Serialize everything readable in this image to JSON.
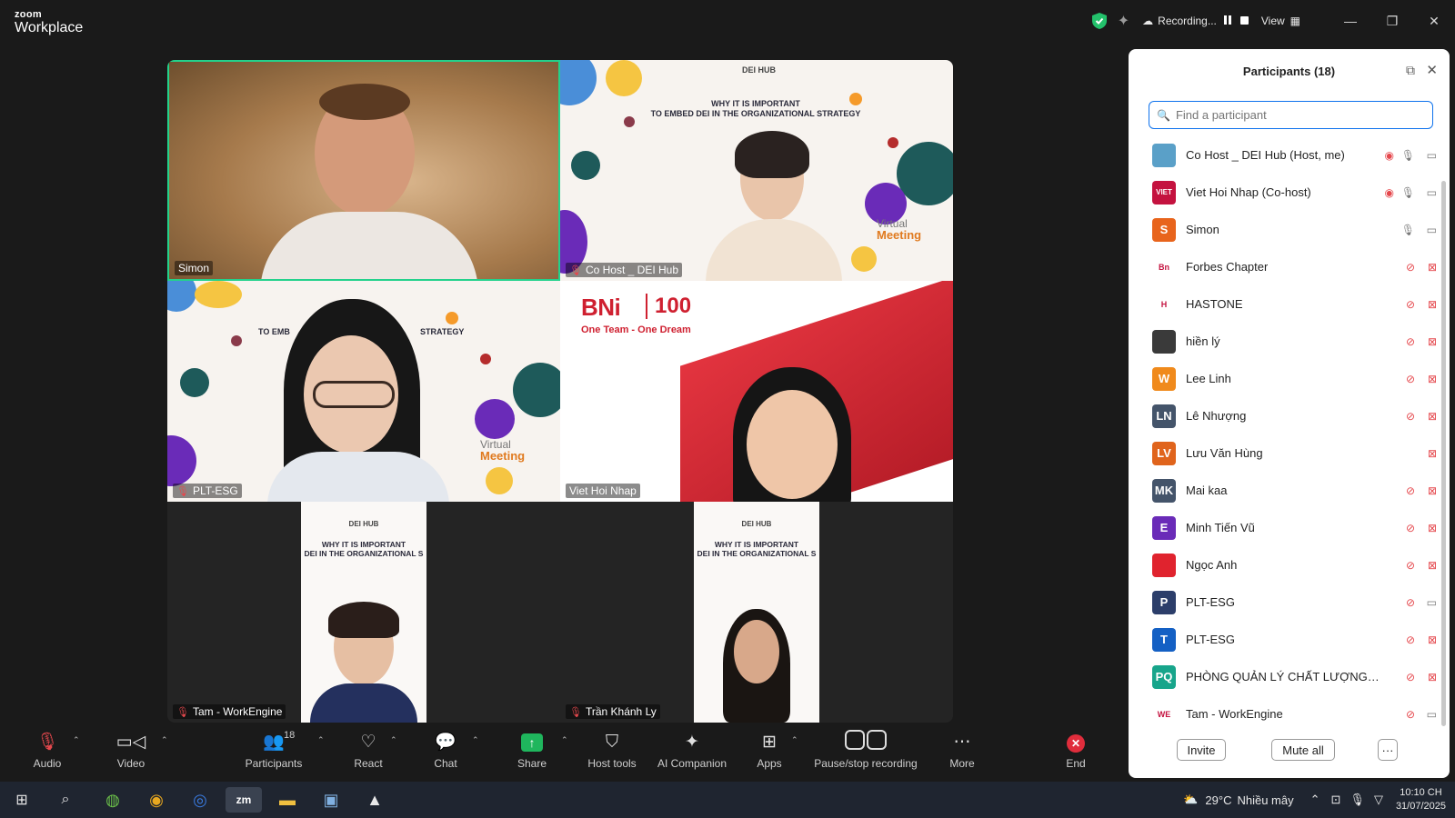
{
  "app": {
    "brand_top": "zoom",
    "brand_bottom": "Workplace"
  },
  "titlebar": {
    "recording_label": "Recording...",
    "view_label": "View"
  },
  "tiles": [
    {
      "name": "Simon"
    },
    {
      "name": "Co Host _ DEI Hub",
      "slide_brand": "DEI HUB",
      "slide_title_1": "WHY IT IS IMPORTANT",
      "slide_title_2": "TO EMBED DEI IN THE ORGANIZATIONAL STRATEGY",
      "vm_1": "Virtual",
      "vm_2": "Meeting"
    },
    {
      "name": "PLT-ESG",
      "slide_left": "TO EMB",
      "slide_right": "STRATEGY",
      "vm_1": "Virtual",
      "vm_2": "Meeting"
    },
    {
      "name": "Viet Hoi Nhap",
      "bni": "BNi",
      "bni_100": "100",
      "bni_tag": "One Team - One Dream"
    },
    {
      "name": "Tam - WorkEngine",
      "slide_brand": "DEI HUB",
      "slide_title_1": "WHY IT IS IMPORTANT",
      "slide_title_2": "DEI IN THE ORGANIZATIONAL S"
    },
    {
      "name": "Trần Khánh Ly",
      "slide_brand": "DEI HUB",
      "slide_title_1": "WHY IT IS IMPORTANT",
      "slide_title_2": "DEI IN THE ORGANIZATIONAL S"
    }
  ],
  "toolbar": {
    "audio": "Audio",
    "video": "Video",
    "participants": "Participants",
    "participants_count": "18",
    "react": "React",
    "chat": "Chat",
    "share": "Share",
    "host_tools": "Host tools",
    "ai_companion": "AI Companion",
    "apps": "Apps",
    "pause_stop_recording": "Pause/stop recording",
    "more": "More",
    "end": "End"
  },
  "panel": {
    "title": "Participants (18)",
    "search_placeholder": "Find a participant",
    "participants": [
      {
        "name": "Co Host _ DEI Hub (Host, me)",
        "avatar_text": "",
        "avatar_color": "#5aa0c8",
        "eye": true,
        "mic": "on",
        "cam": "on"
      },
      {
        "name": "Viet Hoi Nhap (Co-host)",
        "avatar_text": "VIET",
        "avatar_color": "#c4123f",
        "eye": true,
        "mic": "on",
        "cam": "on"
      },
      {
        "name": "Simon",
        "avatar_text": "S",
        "avatar_color": "#e8641c",
        "eye": false,
        "mic": "on",
        "cam": "on"
      },
      {
        "name": "Forbes Chapter",
        "avatar_text": "Bn",
        "avatar_color": "#ffffff",
        "eye": false,
        "mic": "off",
        "cam": "off"
      },
      {
        "name": "HASTONE",
        "avatar_text": "H",
        "avatar_color": "#ffffff",
        "eye": false,
        "mic": "off",
        "cam": "off"
      },
      {
        "name": "hiền lý",
        "avatar_text": "",
        "avatar_color": "#3a3a3a",
        "eye": false,
        "mic": "off",
        "cam": "off"
      },
      {
        "name": "Lee Linh",
        "avatar_text": "W",
        "avatar_color": "#f08a1c",
        "eye": false,
        "mic": "off",
        "cam": "off"
      },
      {
        "name": "Lê Nhượng",
        "avatar_text": "LN",
        "avatar_color": "#44546a",
        "eye": false,
        "mic": "off",
        "cam": "off"
      },
      {
        "name": "Lưu Văn Hùng",
        "avatar_text": "LV",
        "avatar_color": "#e0641c",
        "eye": false,
        "mic": "none",
        "cam": "off"
      },
      {
        "name": "Mai kaa",
        "avatar_text": "MK",
        "avatar_color": "#44546a",
        "eye": false,
        "mic": "off",
        "cam": "off"
      },
      {
        "name": "Minh Tiến Vũ",
        "avatar_text": "E",
        "avatar_color": "#6a2bb8",
        "eye": false,
        "mic": "off",
        "cam": "off"
      },
      {
        "name": "Ngọc Anh",
        "avatar_text": "",
        "avatar_color": "#e0232e",
        "eye": false,
        "mic": "off",
        "cam": "off"
      },
      {
        "name": "PLT-ESG",
        "avatar_text": "P",
        "avatar_color": "#2c3e6a",
        "eye": false,
        "mic": "off",
        "cam": "on"
      },
      {
        "name": "PLT-ESG",
        "avatar_text": "T",
        "avatar_color": "#1460c4",
        "eye": false,
        "mic": "off",
        "cam": "off"
      },
      {
        "name": "PHÒNG QUẢN LÝ CHẤT LƯỢNG_HÙ...",
        "avatar_text": "PQ",
        "avatar_color": "#17a58b",
        "eye": false,
        "mic": "off",
        "cam": "off"
      },
      {
        "name": "Tam - WorkEngine",
        "avatar_text": "WE",
        "avatar_color": "#ffffff",
        "eye": false,
        "mic": "off",
        "cam": "on"
      }
    ],
    "invite": "Invite",
    "mute_all": "Mute all",
    "more": "···"
  },
  "taskbar": {
    "weather": "29°C",
    "weather_desc": "Nhiều mây",
    "time": "10:10 CH",
    "date": "31/07/2025"
  }
}
